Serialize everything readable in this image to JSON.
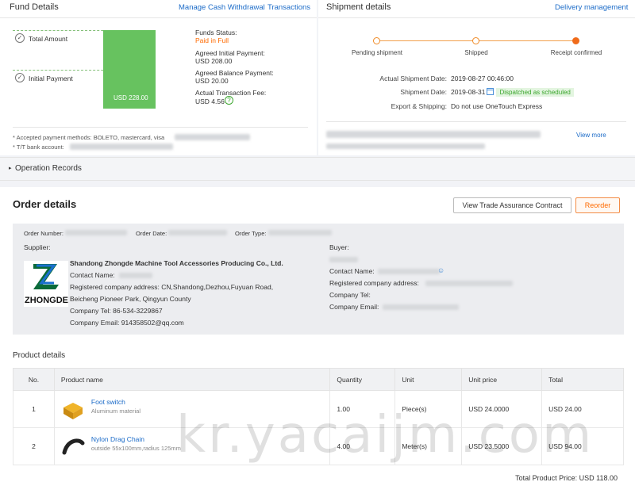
{
  "fund": {
    "title": "Fund Details",
    "links": [
      "Manage Cash Withdrawal",
      "Transactions"
    ],
    "total_amount_label": "Total Amount",
    "initial_payment_label": "Initial Payment",
    "bar_value": "USD 228.00",
    "status_label": "Funds Status:",
    "status_value": "Paid in Full",
    "initial_label": "Agreed Initial Payment:",
    "initial_value": "USD 208.00",
    "balance_label": "Agreed Balance Payment:",
    "balance_value": "USD 20.00",
    "fee_label": "Actual Transaction Fee:",
    "fee_value": "USD 4.56",
    "footnote1": "* Accepted payment methods: BOLETO, mastercard, visa",
    "footnote2": "* T/T bank account:"
  },
  "shipment": {
    "title": "Shipment details",
    "link": "Delivery management",
    "steps": [
      "Pending shipment",
      "Shipped",
      "Receipt confirmed"
    ],
    "actual_label": "Actual Shipment Date:",
    "actual_value": "2019-08-27 00:46:00",
    "ship_label": "Shipment Date:",
    "ship_value": "2019-08-31",
    "ship_badge": "Dispatched as scheduled",
    "export_label": "Export & Shipping:",
    "export_value": "Do not use OneTouch Express",
    "view_more": "View more"
  },
  "operation_records": "Operation Records",
  "order": {
    "title": "Order details",
    "btn_contract": "View Trade Assurance Contract",
    "btn_reorder": "Reorder",
    "order_number_label": "Order Number:",
    "order_date_label": "Order Date:",
    "order_type_label": "Order Type:",
    "supplier_label": "Supplier:",
    "buyer_label": "Buyer:",
    "company": "Shandong Zhongde Machine Tool Accessories Producing Co., Ltd.",
    "contact_label": "Contact Name:",
    "address_line1": "Registered company address: CN,Shandong,Dezhou,Fuyuan Road,",
    "address_line2": "Beicheng Pioneer Park, Qingyun County",
    "tel": "Company Tel: 86-534-3229867",
    "email": "Company Email: 914358502@qq.com",
    "logo_text": "ZHONGDE",
    "buyer_contact": "Contact Name:",
    "buyer_address": "Registered company address:",
    "buyer_tel": "Company Tel:",
    "buyer_email": "Company Email:"
  },
  "products": {
    "title": "Product details",
    "headers": [
      "No.",
      "Product name",
      "Quantity",
      "Unit",
      "Unit price",
      "Total"
    ],
    "rows": [
      {
        "no": "1",
        "name": "Foot switch",
        "material": "Aluminum material",
        "qty": "1.00",
        "unit": "Piece(s)",
        "price": "USD 24.0000",
        "total": "USD 24.00"
      },
      {
        "no": "2",
        "name": "Nylon Drag Chain",
        "material": "outside 55x100mm,radius 125mm",
        "qty": "4.00",
        "unit": "Meter(s)",
        "price": "USD 23.5000",
        "total": "USD 94.00"
      }
    ],
    "total_label": "Total Product Price:",
    "total_value": "USD 118.00"
  },
  "watermark": "kr.yacaijm.com",
  "colors": {
    "accent": "#ff6a00",
    "link": "#1b6bc8",
    "bar": "#67c25f"
  }
}
